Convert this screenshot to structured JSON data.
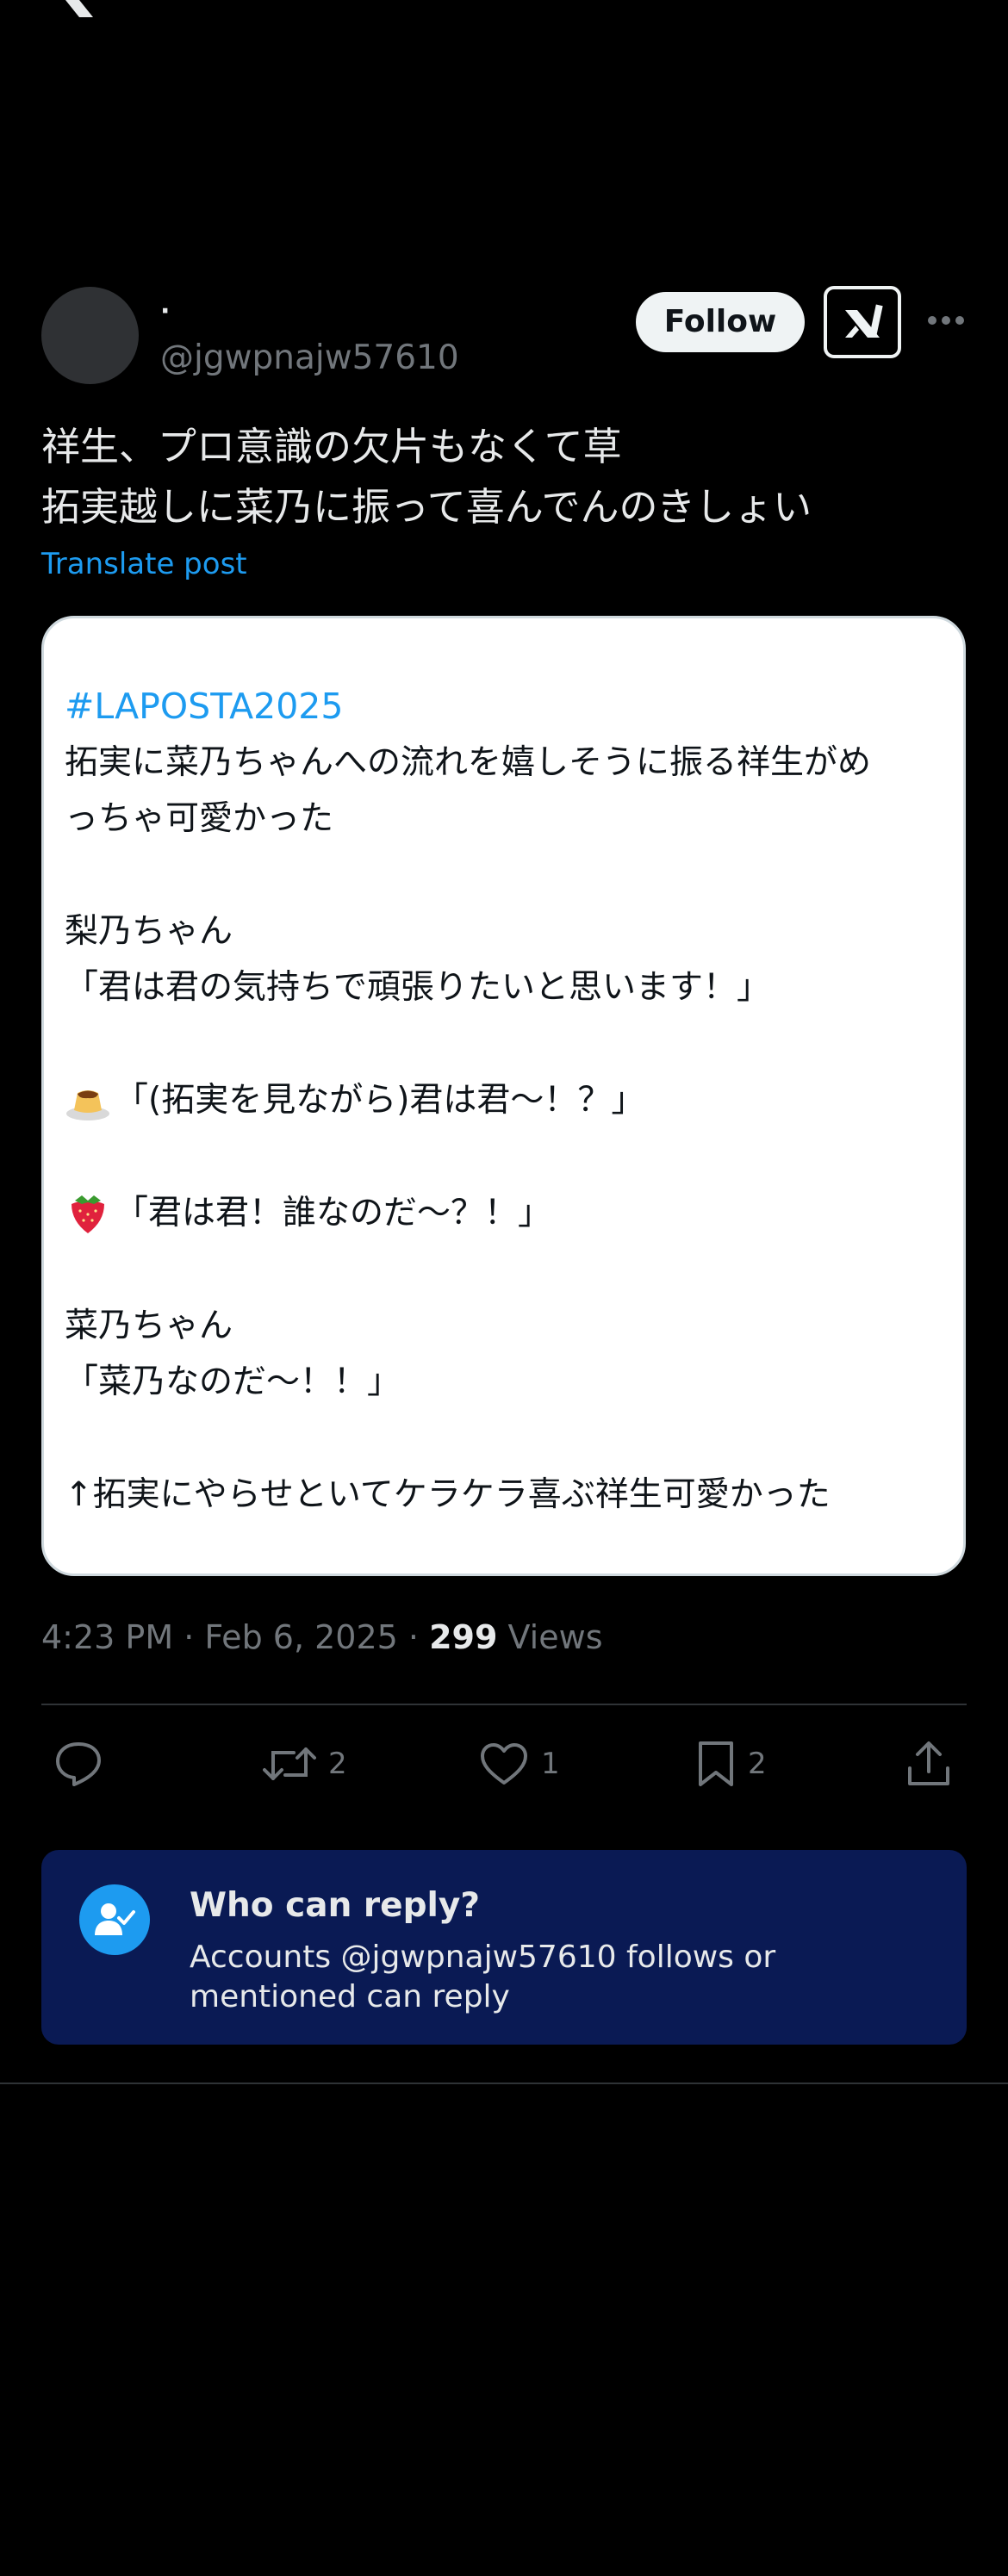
{
  "header": {
    "logo": "x-logo-icon"
  },
  "author": {
    "display_name": "·",
    "handle": "@jgwpnajw57610",
    "follow_label": "Follow"
  },
  "tweet": {
    "lines": [
      "祥生、プロ意識の欠片もなくて草",
      "拓実越しに菜乃に振って喜んでんのきしょい"
    ],
    "translate_label": "Translate post"
  },
  "card": {
    "hashtag": "#LAPOSTA2025",
    "lines": [
      "拓実に菜乃ちゃんへの流れを嬉しそうに振る祥生がめ",
      "っちゃ可愛かった",
      "",
      "梨乃ちゃん",
      "「君は君の気持ちで頑張りたいと思います！」",
      "",
      "「(拓実を見ながら)君は君〜！？」",
      "",
      "「君は君！誰なのだ〜？！」",
      "",
      "菜乃ちゃん",
      "「菜乃なのだ〜！！」",
      "",
      "↑拓実にやらせといてケラケラ喜ぶ祥生可愛かった"
    ],
    "emoji_1": "pudding-emoji-icon",
    "emoji_2": "strawberry-emoji-icon"
  },
  "meta": {
    "time": "4:23 PM",
    "separator": "·",
    "date": "Feb 6, 2025",
    "views_count": "299",
    "views_label": "Views"
  },
  "actions": {
    "reply_icon": "reply-icon",
    "retweets": "2",
    "likes": "1",
    "bookmarks": "2",
    "share_icon": "share-icon"
  },
  "reply_restriction": {
    "title": "Who can reply?",
    "description": "Accounts @jgwpnajw57610 follows or mentioned can reply"
  },
  "colors": {
    "background": "#000000",
    "accent": "#1d9bf0",
    "muted": "#71767b",
    "reply_box": "#0a1a54"
  }
}
